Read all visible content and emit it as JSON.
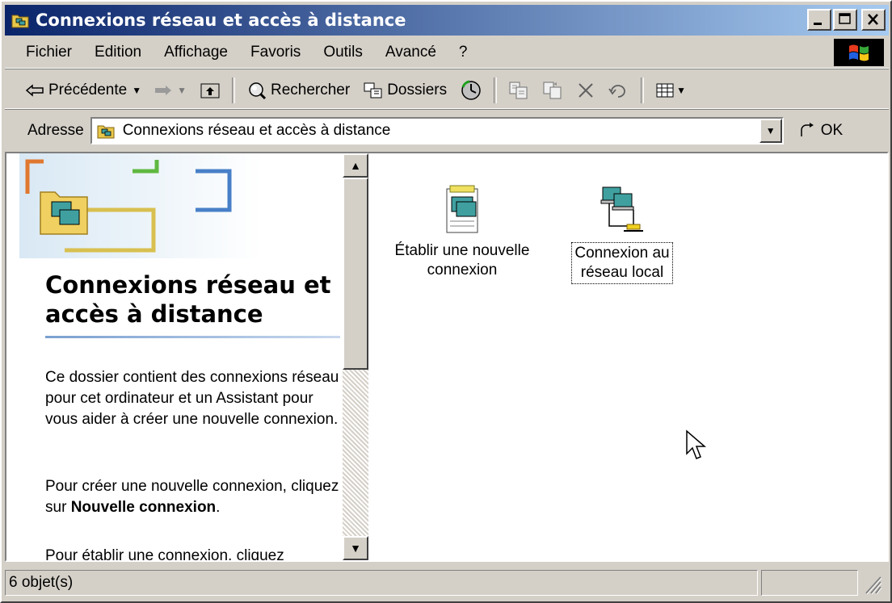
{
  "window": {
    "title": "Connexions réseau et accès à distance",
    "title_gradient_start": "#0a246a",
    "title_gradient_end": "#a6caf0",
    "chrome_color": "#d4d0c8",
    "controls": [
      "minimize-icon",
      "maximize-icon",
      "close-icon"
    ]
  },
  "menubar": {
    "items": [
      "Fichier",
      "Edition",
      "Affichage",
      "Favoris",
      "Outils",
      "Avancé",
      "?"
    ]
  },
  "toolbar": {
    "back_label": "Précédente",
    "search_label": "Rechercher",
    "folders_label": "Dossiers",
    "icons": [
      "back-arrow-icon",
      "forward-arrow-icon",
      "up-folder-icon",
      "search-icon",
      "folders-icon",
      "history-icon",
      "move-to-icon",
      "copy-to-icon",
      "delete-icon",
      "undo-icon",
      "views-icon"
    ]
  },
  "address": {
    "label": "Adresse",
    "value": "Connexions réseau et accès à distance",
    "go_label": "OK"
  },
  "leftpane": {
    "title": "Connexions réseau et accès à distance",
    "para1": "Ce dossier contient des connexions réseau pour cet ordinateur et un Assistant pour vous aider à créer une nouvelle connexion.",
    "para2_pre": "Pour créer une nouvelle connexion, cliquez sur ",
    "para2_bold": "Nouvelle connexion",
    "para2_post": ".",
    "para3": "Pour établir une connexion, cliquez"
  },
  "items": [
    {
      "label_line1": "Établir une nouvelle",
      "label_line2": "connexion",
      "icon": "new-connection-icon"
    },
    {
      "label_line1": "Connexion au",
      "label_line2": "réseau local",
      "icon": "lan-connection-icon",
      "focused": true
    }
  ],
  "statusbar": {
    "count": "6 objet(s)"
  }
}
